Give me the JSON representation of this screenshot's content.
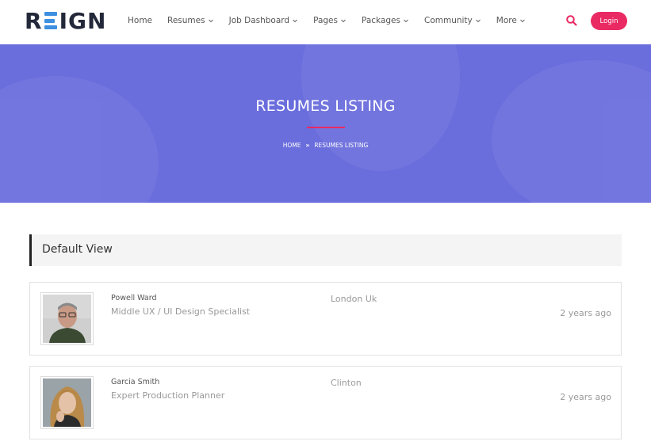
{
  "header": {
    "logo_text": "REIGN",
    "nav": [
      {
        "label": "Home",
        "has_dropdown": false
      },
      {
        "label": "Resumes",
        "has_dropdown": true
      },
      {
        "label": "Job Dashboard",
        "has_dropdown": true
      },
      {
        "label": "Pages",
        "has_dropdown": true
      },
      {
        "label": "Packages",
        "has_dropdown": true
      },
      {
        "label": "Community",
        "has_dropdown": true
      },
      {
        "label": "More",
        "has_dropdown": true
      }
    ],
    "search_icon": "search-icon",
    "login_label": "Login"
  },
  "banner": {
    "title": "RESUMES LISTING",
    "breadcrumb": [
      "HOME",
      "RESUMES LISTING"
    ]
  },
  "section": {
    "title": "Default View"
  },
  "resumes": [
    {
      "name": "Powell Ward",
      "role": "Middle UX / UI Design Specialist",
      "location": "London Uk",
      "posted": "2 years ago"
    },
    {
      "name": "Garcia Smith",
      "role": "Expert Production Planner",
      "location": "Clinton",
      "posted": "2 years ago"
    }
  ],
  "colors": {
    "accent": "#ea2a63",
    "banner": "#6a6ddc",
    "logo_mark": "#3d8fe0",
    "logo_text": "#23283a"
  }
}
